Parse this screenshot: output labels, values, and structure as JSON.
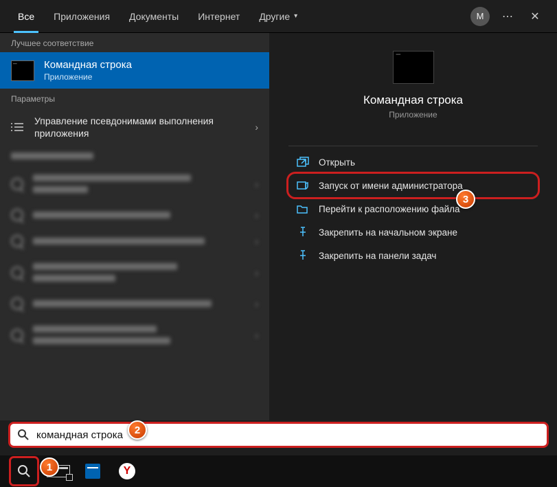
{
  "tabs": {
    "all": "Все",
    "apps": "Приложения",
    "docs": "Документы",
    "web": "Интернет",
    "other": "Другие"
  },
  "avatar_letter": "М",
  "left": {
    "best_match_hdr": "Лучшее соответствие",
    "top_result": {
      "title": "Командная строка",
      "subtitle": "Приложение"
    },
    "settings_hdr": "Параметры",
    "settings_item": "Управление псевдонимами выполнения приложения"
  },
  "preview": {
    "title": "Командная строка",
    "subtitle": "Приложение",
    "actions": {
      "open": "Открыть",
      "run_admin": "Запуск от имени администратора",
      "open_location": "Перейти к расположению файла",
      "pin_start": "Закрепить на начальном экране",
      "pin_taskbar": "Закрепить на панели задач"
    }
  },
  "search": {
    "value": "командная строка"
  },
  "taskbar": {
    "yandex_letter": "Y"
  },
  "annotations": {
    "b1": "1",
    "b2": "2",
    "b3": "3"
  }
}
